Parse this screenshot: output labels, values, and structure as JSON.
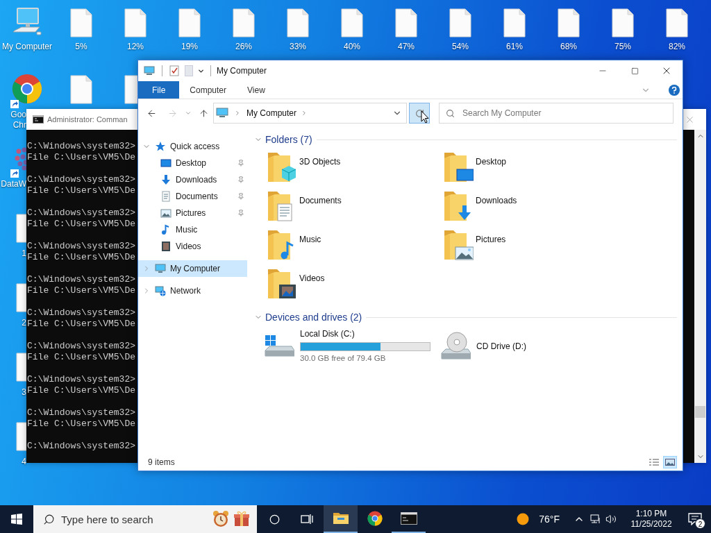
{
  "desktop": {
    "top_row": [
      {
        "kind": "computer",
        "label_lines": [
          "My Computer"
        ]
      },
      {
        "kind": "file",
        "label_lines": [
          "5%"
        ]
      },
      {
        "kind": "file",
        "label_lines": [
          "12%"
        ]
      },
      {
        "kind": "file",
        "label_lines": [
          "19%"
        ]
      },
      {
        "kind": "file",
        "label_lines": [
          "26%"
        ]
      },
      {
        "kind": "file",
        "label_lines": [
          "33%"
        ]
      },
      {
        "kind": "file",
        "label_lines": [
          "40%"
        ]
      },
      {
        "kind": "file",
        "label_lines": [
          "47%"
        ]
      },
      {
        "kind": "file",
        "label_lines": [
          "54%"
        ]
      },
      {
        "kind": "file",
        "label_lines": [
          "61%"
        ]
      },
      {
        "kind": "file",
        "label_lines": [
          "68%"
        ]
      },
      {
        "kind": "file",
        "label_lines": [
          "75%"
        ]
      },
      {
        "kind": "file",
        "label_lines": [
          "82%"
        ]
      }
    ],
    "second_row": [
      {
        "kind": "file"
      },
      {
        "kind": "file"
      }
    ],
    "left_column": [
      {
        "kind": "chrome",
        "label_lines": [
          "Goo",
          "Chr"
        ]
      },
      {
        "kind": "scatter",
        "label_lines": [
          "DataW"
        ]
      },
      {
        "kind": "file",
        "label_lines": [
          "1"
        ]
      },
      {
        "kind": "file",
        "label_lines": [
          "2"
        ]
      },
      {
        "kind": "file",
        "label_lines": [
          "3"
        ]
      },
      {
        "kind": "file",
        "label_lines": [
          "4"
        ]
      }
    ]
  },
  "cmd": {
    "title": "Administrator: Comman",
    "entries": [
      {
        "prompt": "C:\\Windows\\system32>",
        "output": "File C:\\Users\\VM5\\De"
      },
      {
        "prompt": "C:\\Windows\\system32>",
        "output": "File C:\\Users\\VM5\\De"
      },
      {
        "prompt": "C:\\Windows\\system32>",
        "output": "File C:\\Users\\VM5\\De"
      },
      {
        "prompt": "C:\\Windows\\system32>",
        "output": "File C:\\Users\\VM5\\De"
      },
      {
        "prompt": "C:\\Windows\\system32>",
        "output": "File C:\\Users\\VM5\\De"
      },
      {
        "prompt": "C:\\Windows\\system32>",
        "output": "File C:\\Users\\VM5\\De"
      },
      {
        "prompt": "C:\\Windows\\system32>",
        "output": "File C:\\Users\\VM5\\De"
      },
      {
        "prompt": "C:\\Windows\\system32>",
        "output": "File C:\\Users\\VM5\\De"
      },
      {
        "prompt": "C:\\Windows\\system32>",
        "output": "File C:\\Users\\VM5\\De"
      },
      {
        "prompt": "C:\\Windows\\system32>"
      }
    ]
  },
  "explorer": {
    "title": "My Computer",
    "ribbon_tabs": [
      {
        "label": "File",
        "selected": true
      },
      {
        "label": "Computer",
        "selected": false
      },
      {
        "label": "View",
        "selected": false
      }
    ],
    "address": "My Computer",
    "search": {
      "placeholder": "Search My Computer"
    },
    "nav": [
      {
        "label": "Quick access",
        "kind": "star",
        "expanded": true,
        "selected": false,
        "children": [
          {
            "label": "Desktop",
            "kind": "desktop",
            "pinned": true,
            "selected": false
          },
          {
            "label": "Downloads",
            "kind": "downloads",
            "pinned": true,
            "selected": false
          },
          {
            "label": "Documents",
            "kind": "documents",
            "pinned": true,
            "selected": false
          },
          {
            "label": "Pictures",
            "kind": "pictures",
            "pinned": true,
            "selected": false
          },
          {
            "label": "Music",
            "kind": "music",
            "pinned": false,
            "selected": false
          },
          {
            "label": "Videos",
            "kind": "videos",
            "pinned": false,
            "selected": false
          }
        ]
      },
      {
        "label": "My Computer",
        "kind": "computer",
        "expanded": false,
        "selected": true
      },
      {
        "label": "Network",
        "kind": "network",
        "expanded": false,
        "selected": false
      }
    ],
    "folders": {
      "title": "Folders (7)",
      "expanded": true,
      "items": [
        {
          "name": "3D Objects",
          "kind": "objects"
        },
        {
          "name": "Desktop",
          "kind": "desktop"
        },
        {
          "name": "Documents",
          "kind": "documents"
        },
        {
          "name": "Downloads",
          "kind": "downloads"
        },
        {
          "name": "Music",
          "kind": "music"
        },
        {
          "name": "Pictures",
          "kind": "pictures"
        },
        {
          "name": "Videos",
          "kind": "videos"
        }
      ]
    },
    "drives": {
      "title": "Devices and drives (2)",
      "expanded": true,
      "items": [
        {
          "name": "Local Disk (C:)",
          "kind": "disk",
          "level": 0.62,
          "free": "30.0 GB free of 79.4 GB"
        },
        {
          "name": "CD Drive (D:)",
          "kind": "cd"
        }
      ]
    },
    "status": "9 items",
    "view_modes": [
      {
        "kind": "details",
        "selected": false
      },
      {
        "kind": "large-icons",
        "selected": true
      }
    ]
  },
  "taskbar": {
    "search": {
      "placeholder": "Type here to search"
    },
    "apps": [
      {
        "kind": "explorer",
        "selected": true,
        "running": true
      },
      {
        "kind": "chrome",
        "selected": false,
        "running": false
      },
      {
        "kind": "cmd",
        "selected": false,
        "running": true
      }
    ],
    "weather": "76°F",
    "time": "1:10 PM",
    "date": "11/25/2022",
    "notifications": "2"
  }
}
